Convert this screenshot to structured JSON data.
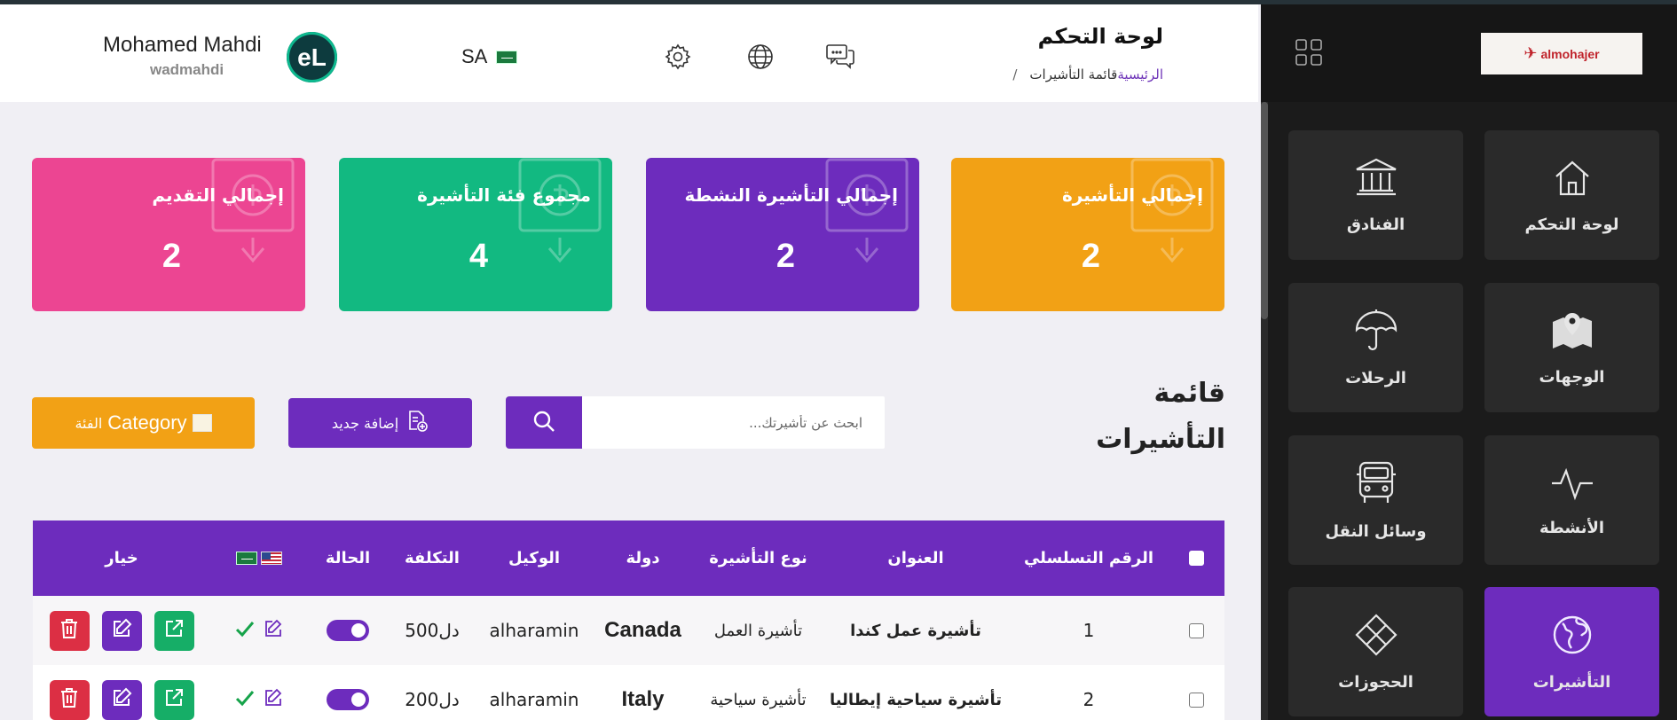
{
  "header": {
    "title": "لوحة التحكم",
    "breadcrumb": {
      "home": "الرئيسية",
      "current": "قائمة التأشيرات",
      "separator": "/"
    },
    "language_code": "SA",
    "user": {
      "name": "Mohamed Mahdi",
      "handle": "wadmahdi",
      "avatar_text": "eL"
    }
  },
  "sidebar": {
    "logo_text": "almohajer",
    "items": [
      {
        "label": "لوحة التحكم",
        "icon": "home-icon"
      },
      {
        "label": "الفنادق",
        "icon": "bank-icon"
      },
      {
        "label": "الوجهات",
        "icon": "map-icon"
      },
      {
        "label": "الرحلات",
        "icon": "umbrella-icon"
      },
      {
        "label": "الأنشطة",
        "icon": "activity-icon"
      },
      {
        "label": "وسائل النقل",
        "icon": "bus-icon"
      },
      {
        "label": "التأشيرات",
        "icon": "globe-icon",
        "active": true
      },
      {
        "label": "الحجوزات",
        "icon": "diamond-icon"
      }
    ],
    "active_color": "#6d2cbd"
  },
  "stats": [
    {
      "title": "إجمالي التأشيرة",
      "value": "2",
      "color": "#f2a115"
    },
    {
      "title": "إجمالي التأشيرة النشطة",
      "value": "2",
      "color": "#6d2cbd"
    },
    {
      "title": "مجموع فئة التأشيرة",
      "value": "4",
      "color": "#12b981"
    },
    {
      "title": "إجمالي التقديم",
      "value": "2",
      "color": "#ec4592"
    }
  ],
  "list": {
    "title": "قائمة التأشيرات",
    "search_placeholder": "ابحث عن تأشيرتك...",
    "add_label": "إضافة جديد",
    "category_label": "Category",
    "category_label_ar": "الفئة"
  },
  "table": {
    "columns": [
      "الرقم التسلسلي",
      "العنوان",
      "نوع التأشيرة",
      "دولة",
      "الوكيل",
      "التكلفة",
      "الحالة",
      "خيار"
    ],
    "rows": [
      {
        "serial": "1",
        "title": "تأشيرة عمل كندا",
        "type": "تأشيرة العمل",
        "country": "Canada",
        "agent": "alharamin",
        "cost": "دل500",
        "status": "active"
      },
      {
        "serial": "2",
        "title": "تأشيرة سياحية إيطاليا",
        "type": "تأشيرة سياحية",
        "country": "Italy",
        "agent": "alharamin",
        "cost": "دل200",
        "status": "active"
      }
    ]
  }
}
